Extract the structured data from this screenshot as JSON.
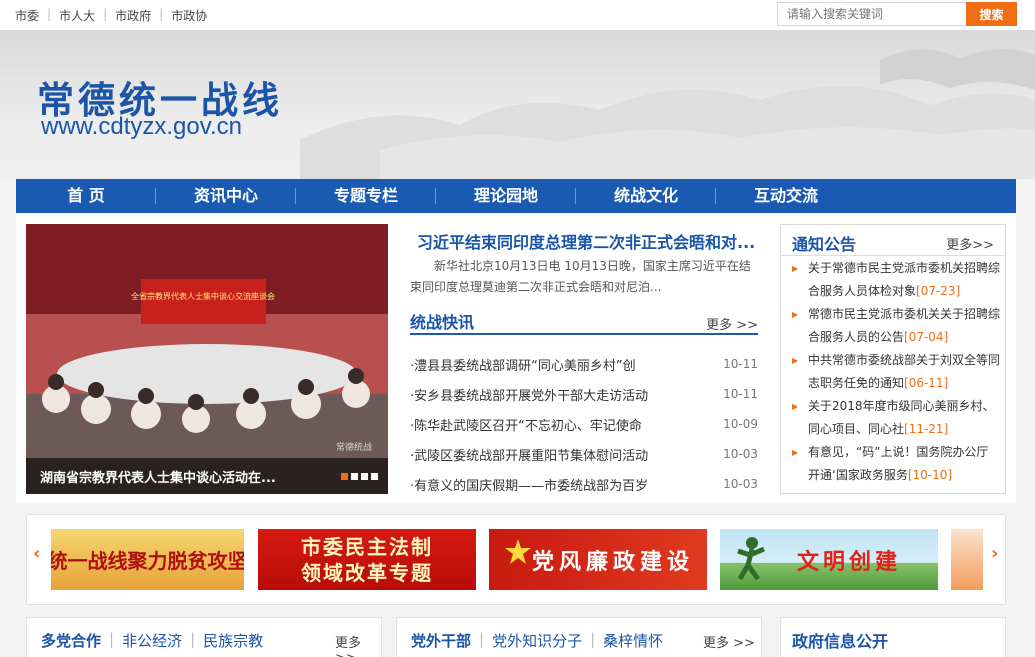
{
  "top_links": [
    "市委",
    "市人大",
    "市政府",
    "市政协"
  ],
  "search": {
    "placeholder": "请输入搜索关键词",
    "button": "搜索"
  },
  "site": {
    "title": "常德统一战线",
    "url": "www.cdtyzx.gov.cn"
  },
  "nav": [
    "首 页",
    "资讯中心",
    "专题专栏",
    "理论园地",
    "统战文化",
    "互动交流"
  ],
  "slideshow": {
    "caption": "湖南省宗教界代表人士集中谈心活动在...",
    "photo_banner": "全省宗教界代表人士集中谈心交流座谈会",
    "watermark": "常德统战",
    "active_dot": 1,
    "dot_count": 4
  },
  "headline": {
    "title": "习近平结束同印度总理第二次非正式会晤和对...",
    "summary": "新华社北京10月13日电 10月13日晚，国家主席习近平在结束同印度总理莫迪第二次非正式会晤和对尼泊..."
  },
  "news_section": {
    "title": "统战快讯",
    "more": "更多 >>",
    "items": [
      {
        "text": "·澧县县委统战部调研“同心美丽乡村”创",
        "date": "10-11"
      },
      {
        "text": "·安乡县委统战部开展党外干部大走访活动",
        "date": "10-11"
      },
      {
        "text": "·陈华赴武陵区召开“不忘初心、牢记使命",
        "date": "10-09"
      },
      {
        "text": "·武陵区委统战部开展重阳节集体慰问活动",
        "date": "10-03"
      },
      {
        "text": "·有意义的国庆假期——市委统战部为百岁",
        "date": "10-03"
      }
    ]
  },
  "notice": {
    "title": "通知公告",
    "more": "更多>>",
    "items": [
      {
        "text": "关于常德市民主党派市委机关招聘综合服务人员体检对象",
        "date": "[07-23]"
      },
      {
        "text": "常德市民主党派市委机关关于招聘综合服务人员的公告",
        "date": "[07-04]"
      },
      {
        "text": "中共常德市委统战部关于刘双全等同志职务任免的通知",
        "date": "[06-11]"
      },
      {
        "text": "关于2018年度市级同心美丽乡村、同心项目、同心社",
        "date": "[11-21]"
      },
      {
        "text": "有意见，“码”上说！国务院办公厅开通‘国家政务服务",
        "date": "[10-10]"
      }
    ]
  },
  "specials": {
    "banner1": "统一战线聚力脱贫攻坚",
    "banner2_line1": "市委民主法制",
    "banner2_line2": "领域改革专题",
    "banner3": "党风廉政建设",
    "banner4": "文明创建",
    "arrow_left": "‹",
    "arrow_right": "›"
  },
  "bottom": {
    "sec1": {
      "tabs": [
        "多党合作",
        "非公经济",
        "民族宗教"
      ],
      "more": "更多 >>"
    },
    "sec2": {
      "tabs": [
        "党外干部",
        "党外知识分子",
        "桑梓情怀"
      ],
      "more": "更多 >>"
    },
    "gov": "政府信息公开"
  },
  "colors": {
    "brand_blue": "#1b5ab3",
    "accent_orange": "#ef6d14"
  }
}
